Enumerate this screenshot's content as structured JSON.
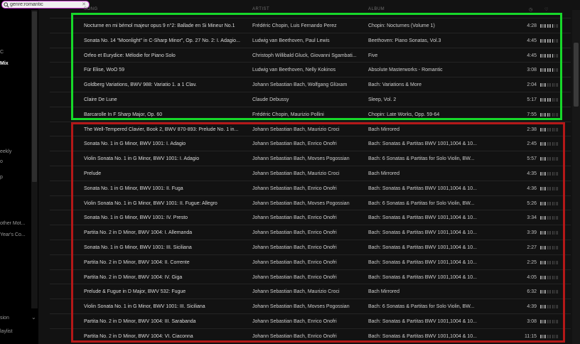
{
  "search": {
    "value": "genre:romantic",
    "placeholder": "",
    "icon": "search-icon"
  },
  "sidebar": {
    "items": [
      "C",
      "Mix",
      "eekly",
      "o",
      "p",
      "other Mot...",
      "Year's Co...",
      "sion",
      "laylist"
    ],
    "active_index": 1
  },
  "header": {
    "song": "SONG",
    "artist": "ARTIST",
    "album": "ALBUM"
  },
  "highlight_colors": {
    "green": "#17d82a",
    "red": "#b41818",
    "search_outline": "#c02fc8"
  },
  "tracks": [
    {
      "title": "Nocturne en mi bémol majeur opus 9 n°2: Ballade en Si Mineur No.1",
      "artist": "Frédéric Chopin, Luis Fernando Perez",
      "album": "Chopin: Nocturnes (Volume 1)",
      "duration": "4:28",
      "popularity": 0.7
    },
    {
      "title": "Sonata No. 14 \"Moonlight\" in C-Sharp Minor\", Op. 27 No. 2: I. Adagio...",
      "artist": "Ludwig van Beethoven, Paul Lewis",
      "album": "Beethoven: Piano Sonatas, Vol.3",
      "duration": "4:45",
      "popularity": 0.75
    },
    {
      "title": "Orfeo et Eurydice: Mélodie for Piano Solo",
      "artist": "Christoph Willibald Gluck, Giovanni Sgambati...",
      "album": "Five",
      "duration": "4:45",
      "popularity": 0.75
    },
    {
      "title": "Für Elise, WoO 59",
      "artist": "Ludwig van Beethoven, Nelly Kokinos",
      "album": "Absolute Masterworks - Romantic",
      "duration": "3:08",
      "popularity": 0.7
    },
    {
      "title": "Goldberg Variations, BWV 988: Variatio 1. a 1 Clav.",
      "artist": "Johann Sebastian Bach, Wolfgang Glüxam",
      "album": "Bach: Variations & More",
      "duration": "2:04",
      "popularity": 0.4
    },
    {
      "title": "Claire De Lune",
      "artist": "Claude Debussy",
      "album": "Sleep, Vol. 2",
      "duration": "5:17",
      "popularity": 0.6
    },
    {
      "title": "Barcarolle In F Sharp Major, Op. 60",
      "artist": "Frédéric Chopin, Maurizio Pollini",
      "album": "Chopin: Late Works, Opp. 59-64",
      "duration": "7:55",
      "popularity": 0.5
    },
    {
      "title": "The Well-Tempered Clavier, Book 2, BWV 870-893: Prelude No. 1 in...",
      "artist": "Johann Sebastian Bach, Maurizio Croci",
      "album": "Bach Mirrored",
      "duration": "2:38",
      "popularity": 0.4
    },
    {
      "title": "Sonata No. 1 in G Minor, BWV 1001: I. Adagio",
      "artist": "Johann Sebastian Bach, Enrico Onofri",
      "album": "Bach: Sonatas & Partitas BWV 1001,1004 & 10...",
      "duration": "2:45",
      "popularity": 0.4
    },
    {
      "title": "Violin Sonata No. 1 in G Minor, BWV 1001: I. Adagio",
      "artist": "Johann Sebastian Bach, Movses Pogossian",
      "album": "Bach: 6 Sonatas & Partitas for Solo Violin, BW...",
      "duration": "5:57",
      "popularity": 0.4
    },
    {
      "title": "Prelude",
      "artist": "Johann Sebastian Bach, Maurizio Croci",
      "album": "Bach Mirrored",
      "duration": "4:35",
      "popularity": 0.4
    },
    {
      "title": "Sonata No. 1 in G Minor, BWV 1001: II. Fuga",
      "artist": "Johann Sebastian Bach, Enrico Onofri",
      "album": "Bach: Sonatas & Partitas BWV 1001,1004 & 10...",
      "duration": "4:36",
      "popularity": 0.4
    },
    {
      "title": "Violin Sonata No. 1 in G Minor, BWV 1001: II. Fugue: Allegro",
      "artist": "Johann Sebastian Bach, Movses Pogossian",
      "album": "Bach: 6 Sonatas & Partitas for Solo Violin, BW...",
      "duration": "5:26",
      "popularity": 0.4
    },
    {
      "title": "Sonata No. 1 in G Minor, BWV 1001: IV. Presto",
      "artist": "Johann Sebastian Bach, Enrico Onofri",
      "album": "Bach: Sonatas & Partitas BWV 1001,1004 & 10...",
      "duration": "3:34",
      "popularity": 0.4
    },
    {
      "title": "Partita No. 2 in D Minor, BWV 1004: I. Allemanda",
      "artist": "Johann Sebastian Bach, Enrico Onofri",
      "album": "Bach: Sonatas & Partitas BWV 1001,1004 & 10...",
      "duration": "3:39",
      "popularity": 0.4
    },
    {
      "title": "Sonata No. 1 in G Minor, BWV 1001: III. Siciliana",
      "artist": "Johann Sebastian Bach, Enrico Onofri",
      "album": "Bach: Sonatas & Partitas BWV 1001,1004 & 10...",
      "duration": "2:27",
      "popularity": 0.4
    },
    {
      "title": "Partita No. 2 in D Minor, BWV 1004: II. Corrente",
      "artist": "Johann Sebastian Bach, Enrico Onofri",
      "album": "Bach: Sonatas & Partitas BWV 1001,1004 & 10...",
      "duration": "2:25",
      "popularity": 0.4
    },
    {
      "title": "Partita No. 2 in D Minor, BWV 1004: IV. Giga",
      "artist": "Johann Sebastian Bach, Enrico Onofri",
      "album": "Bach: Sonatas & Partitas BWV 1001,1004 & 10...",
      "duration": "4:05",
      "popularity": 0.4
    },
    {
      "title": "Prelude & Fugue in D Major, BWV 532: Fugue",
      "artist": "Johann Sebastian Bach, Maurizio Croci",
      "album": "Bach Mirrored",
      "duration": "6:32",
      "popularity": 0.4
    },
    {
      "title": "Violin Sonata No. 1 in G Minor, BWV 1001: III. Siciliana",
      "artist": "Johann Sebastian Bach, Movses Pogossian",
      "album": "Bach: 6 Sonatas & Partitas for Solo Violin, BW...",
      "duration": "4:39",
      "popularity": 0.4
    },
    {
      "title": "Partita No. 2 in D Minor, BWV 1004: III. Sarabanda",
      "artist": "Johann Sebastian Bach, Enrico Onofri",
      "album": "Bach: Sonatas & Partitas BWV 1001,1004 & 10...",
      "duration": "3:08",
      "popularity": 0.4
    },
    {
      "title": "Partita No. 2 in D Minor, BWV 1004: VI. Ciaconna",
      "artist": "Johann Sebastian Bach, Enrico Onofri",
      "album": "Bach: Sonatas & Partitas BWV 1001,1004 & 10...",
      "duration": "11:15",
      "popularity": 0.4
    }
  ]
}
